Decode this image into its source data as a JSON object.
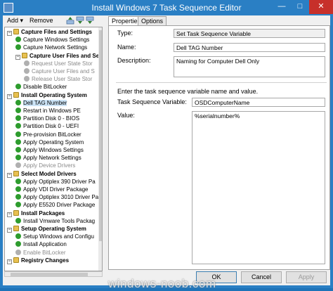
{
  "window": {
    "title": "Install Windows 7 Task Sequence Editor",
    "min_glyph": "—",
    "max_glyph": "□",
    "close_glyph": "✕"
  },
  "toolbar": {
    "add_label": "Add ▾",
    "remove_label": "Remove"
  },
  "tree": {
    "items": [
      {
        "label": "Capture Files and Settings",
        "level": 0,
        "type": "group",
        "icon": "folder",
        "expanded": true
      },
      {
        "label": "Capture Windows Settings",
        "level": 1,
        "type": "step",
        "icon": "check"
      },
      {
        "label": "Capture Network Settings",
        "level": 1,
        "type": "step",
        "icon": "check"
      },
      {
        "label": "Capture User Files and Se",
        "level": 1,
        "type": "group",
        "icon": "folder",
        "expanded": true
      },
      {
        "label": "Request User State Stor",
        "level": 2,
        "type": "step",
        "icon": "gray",
        "disabled": true
      },
      {
        "label": "Capture User Files and S",
        "level": 2,
        "type": "step",
        "icon": "gray",
        "disabled": true
      },
      {
        "label": "Release User State Stor",
        "level": 2,
        "type": "step",
        "icon": "gray",
        "disabled": true
      },
      {
        "label": "Disable BitLocker",
        "level": 1,
        "type": "step",
        "icon": "check"
      },
      {
        "label": "Install Operating System",
        "level": 0,
        "type": "group",
        "icon": "folder",
        "expanded": true
      },
      {
        "label": "Dell TAG Number",
        "level": 1,
        "type": "step",
        "icon": "check",
        "selected": true
      },
      {
        "label": "Restart in Windows PE",
        "level": 1,
        "type": "step",
        "icon": "check"
      },
      {
        "label": "Partition Disk 0 - BIOS",
        "level": 1,
        "type": "step",
        "icon": "check"
      },
      {
        "label": "Partition Disk 0 - UEFI",
        "level": 1,
        "type": "step",
        "icon": "check"
      },
      {
        "label": "Pre-provision BitLocker",
        "level": 1,
        "type": "step",
        "icon": "check"
      },
      {
        "label": "Apply Operating System",
        "level": 1,
        "type": "step",
        "icon": "check"
      },
      {
        "label": "Apply Windows Settings",
        "level": 1,
        "type": "step",
        "icon": "check"
      },
      {
        "label": "Apply Network Settings",
        "level": 1,
        "type": "step",
        "icon": "check"
      },
      {
        "label": "Apply Device Drivers",
        "level": 1,
        "type": "step",
        "icon": "gray",
        "disabled": true
      },
      {
        "label": "Select Model Drivers",
        "level": 0,
        "type": "group",
        "icon": "folder",
        "expanded": true
      },
      {
        "label": "Apply Optiplex 390 Driver Pa",
        "level": 1,
        "type": "step",
        "icon": "check"
      },
      {
        "label": "Apply VDI Driver Package",
        "level": 1,
        "type": "step",
        "icon": "check"
      },
      {
        "label": "Apply Optiplex 3010 Driver Pa",
        "level": 1,
        "type": "step",
        "icon": "check"
      },
      {
        "label": "Apply E5520 Driver Package",
        "level": 1,
        "type": "step",
        "icon": "check"
      },
      {
        "label": "Install Packages",
        "level": 0,
        "type": "group",
        "icon": "folder",
        "expanded": true
      },
      {
        "label": "Install Vmware Tools Packag",
        "level": 1,
        "type": "step",
        "icon": "check"
      },
      {
        "label": "Setup Operating System",
        "level": 0,
        "type": "group",
        "icon": "folder",
        "expanded": true
      },
      {
        "label": "Setup Windows and Configu",
        "level": 1,
        "type": "step",
        "icon": "check"
      },
      {
        "label": "Install Application",
        "level": 1,
        "type": "step",
        "icon": "check"
      },
      {
        "label": "Enable BitLocker",
        "level": 1,
        "type": "step",
        "icon": "gray",
        "disabled": true
      },
      {
        "label": "Registry Changes",
        "level": 0,
        "type": "group",
        "icon": "folder",
        "expanded": true
      }
    ]
  },
  "tabs": [
    {
      "label": "Properties",
      "active": true
    },
    {
      "label": "Options",
      "active": false
    }
  ],
  "properties": {
    "type_label": "Type:",
    "type_value": "Set Task Sequence Variable",
    "name_label": "Name:",
    "name_value": "Dell TAG Number",
    "description_label": "Description:",
    "description_value": "Naming for Computer Dell Only",
    "instruction": "Enter the task sequence variable name and value.",
    "variable_label": "Task Sequence Variable:",
    "variable_value": "OSDComputerName",
    "value_label": "Value:",
    "value_value": "%serialnumber%"
  },
  "buttons": {
    "ok": "OK",
    "cancel": "Cancel",
    "apply": "Apply"
  },
  "watermark": "windows-noob.com",
  "colors": {
    "titlebar": "#2a7fc4",
    "close": "#c7302a",
    "success": "#2e9c2e",
    "selection": "#cce4f7"
  }
}
